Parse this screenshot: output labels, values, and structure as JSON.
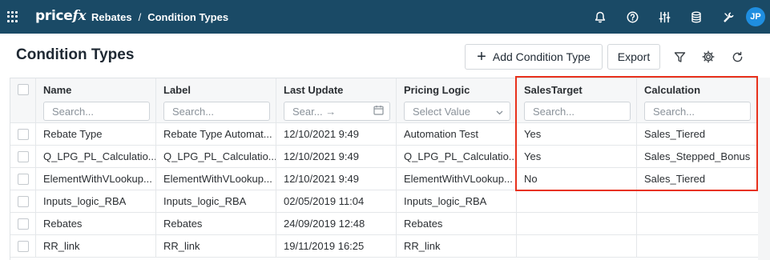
{
  "topbar": {
    "logo_main": "price",
    "logo_fx": "fx",
    "breadcrumb": [
      "Rebates",
      "/",
      "Condition Types"
    ],
    "avatar_initials": "JP",
    "icons": [
      "bell-icon",
      "help-icon",
      "sliders-icon",
      "database-icon",
      "tools-icon"
    ]
  },
  "page": {
    "title": "Condition Types",
    "add_button": "Add Condition Type",
    "export_button": "Export"
  },
  "grid": {
    "columns": [
      {
        "label": "Name",
        "filter": "Search..."
      },
      {
        "label": "Label",
        "filter": "Search..."
      },
      {
        "label": "Last Update",
        "filter": "Sear... →"
      },
      {
        "label": "Pricing Logic",
        "filter": "Select Value"
      },
      {
        "label": "SalesTarget",
        "filter": "Search..."
      },
      {
        "label": "Calculation",
        "filter": "Search..."
      }
    ],
    "rows": [
      [
        "Rebate Type",
        "Rebate Type Automat...",
        "12/10/2021 9:49",
        "Automation Test",
        "Yes",
        "Sales_Tiered"
      ],
      [
        "Q_LPG_PL_Calculatio...",
        "Q_LPG_PL_Calculatio...",
        "12/10/2021 9:49",
        "Q_LPG_PL_Calculatio...",
        "Yes",
        "Sales_Stepped_Bonus"
      ],
      [
        "ElementWithVLookup...",
        "ElementWithVLookup...",
        "12/10/2021 9:49",
        "ElementWithVLookup...",
        "No",
        "Sales_Tiered"
      ],
      [
        "Inputs_logic_RBA",
        "Inputs_logic_RBA",
        "02/05/2019 11:04",
        "Inputs_logic_RBA",
        "",
        ""
      ],
      [
        "Rebates",
        "Rebates",
        "24/09/2019 12:48",
        "Rebates",
        "",
        ""
      ],
      [
        "RR_link",
        "RR_link",
        "19/11/2019 16:25",
        "RR_link",
        "",
        ""
      ]
    ]
  },
  "colors": {
    "topbar": "#1a4a66",
    "avatar": "#1f8ee0",
    "highlight": "#e8311c"
  }
}
